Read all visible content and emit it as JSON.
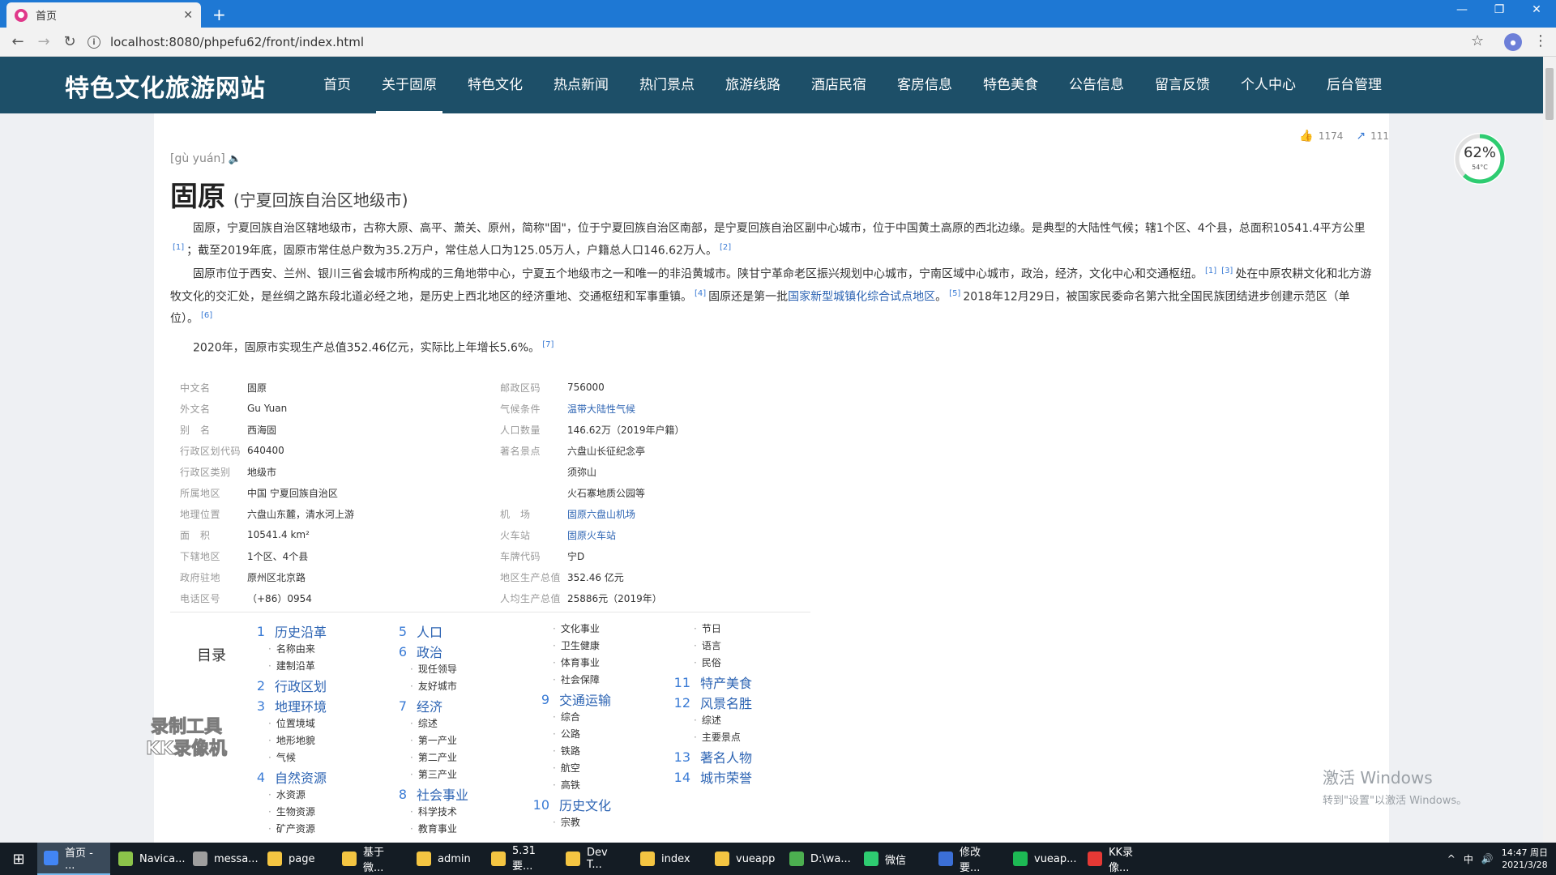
{
  "browser": {
    "tab_title": "首页",
    "url": "localhost:8080/phpefu62/front/index.html"
  },
  "site": {
    "logo": "特色文化旅游网站",
    "nav": [
      "首页",
      "关于固原",
      "特色文化",
      "热点新闻",
      "热门景点",
      "旅游线路",
      "酒店民宿",
      "客房信息",
      "特色美食",
      "公告信息",
      "留言反馈",
      "个人中心",
      "后台管理"
    ],
    "active_nav": "关于固原"
  },
  "article": {
    "likes": "1174",
    "shares": "111",
    "pinyin": "[gù yuán]",
    "title": "固原",
    "subtitle": "(宁夏回族自治区地级市)",
    "p1a": "固原，宁夏回族自治区辖地级市，古称大原、高平、萧关、原州，简称\"固\"，位于宁夏回族自治区南部，是宁夏回族自治区副中心城市，位于中国黄土高原的西北边缘。是典型的大陆性气候；辖1个区、4个县，总面积10541.4平方公里",
    "p1b": "；截至2019年底，固原市常住总户数为35.2万户，常住总人口为125.05万人，户籍总人口146.62万人。",
    "p2a": "固原市位于西安、兰州、银川三省会城市所构成的三角地带中心，宁夏五个地级市之一和唯一的非沿黄城市。陕甘宁革命老区振兴规划中心城市，宁南区域中心城市，政治，经济，文化中心和交通枢纽。",
    "p2b": "处在中原农耕文化和北方游牧文化的交汇处，是丝绸之路东段北道必经之地，是历史上西北地区的经济重地、交通枢纽和军事重镇。",
    "p2c": "固原还是第一批",
    "p2link": "国家新型城镇化综合试点地区",
    "p2d": "。",
    "p2e": "2018年12月29日，被国家民委命名第六批全国民族团结进步创建示范区（单位）。",
    "p3": "2020年，固原市实现生产总值352.46亿元，实际比上年增长5.6%。",
    "refs": [
      "[1]",
      "[2]",
      "[1]",
      "[3]",
      "[4]",
      "[5]",
      "[6]",
      "[7]"
    ]
  },
  "infobox": [
    {
      "k1": "中文名",
      "v1": "固原",
      "k2": "邮政区码",
      "v2": "756000"
    },
    {
      "k1": "外文名",
      "v1": "Gu Yuan",
      "k2": "气候条件",
      "v2": "温带大陆性气候"
    },
    {
      "k1": "别　名",
      "v1": "西海固",
      "k2": "人口数量",
      "v2": "146.62万（2019年户籍）"
    },
    {
      "k1": "行政区划代码",
      "v1": "640400",
      "k2": "著名景点",
      "v2": "六盘山长征纪念亭"
    },
    {
      "k1": "行政区类别",
      "v1": "地级市",
      "k2": "",
      "v2": "须弥山"
    },
    {
      "k1": "所属地区",
      "v1": "中国 宁夏回族自治区",
      "k2": "",
      "v2": "火石寨地质公园等"
    },
    {
      "k1": "地理位置",
      "v1": "六盘山东麓，清水河上游",
      "k2": "机　场",
      "v2": "固原六盘山机场"
    },
    {
      "k1": "面　积",
      "v1": "10541.4 km²",
      "k2": "火车站",
      "v2": "固原火车站"
    },
    {
      "k1": "下辖地区",
      "v1": "1个区、4个县",
      "k2": "车牌代码",
      "v2": "宁D"
    },
    {
      "k1": "政府驻地",
      "v1": "原州区北京路",
      "k2": "地区生产总值",
      "v2": "352.46 亿元"
    },
    {
      "k1": "电话区号",
      "v1": "（+86）0954",
      "k2": "人均生产总值",
      "v2": "25886元（2019年）"
    }
  ],
  "toc": {
    "label": "目录",
    "col1": [
      {
        "n": "1",
        "t": "历史沿革",
        "subs": [
          "名称由来",
          "建制沿革"
        ]
      },
      {
        "n": "2",
        "t": "行政区划",
        "subs": []
      },
      {
        "n": "3",
        "t": "地理环境",
        "subs": [
          "位置境域",
          "地形地貌",
          "气候"
        ]
      },
      {
        "n": "4",
        "t": "自然资源",
        "subs": [
          "水资源",
          "生物资源",
          "矿产资源"
        ]
      }
    ],
    "col2": [
      {
        "n": "5",
        "t": "人口",
        "subs": []
      },
      {
        "n": "6",
        "t": "政治",
        "subs": [
          "现任领导",
          "友好城市"
        ]
      },
      {
        "n": "7",
        "t": "经济",
        "subs": [
          "综述",
          "第一产业",
          "第二产业",
          "第三产业"
        ]
      },
      {
        "n": "8",
        "t": "社会事业",
        "subs": [
          "科学技术",
          "教育事业"
        ]
      }
    ],
    "col3_pre": [
      "文化事业",
      "卫生健康",
      "体育事业",
      "社会保障"
    ],
    "col3": [
      {
        "n": "9",
        "t": "交通运输",
        "subs": [
          "综合",
          "公路",
          "铁路",
          "航空",
          "高铁"
        ]
      },
      {
        "n": "10",
        "t": "历史文化",
        "subs": [
          "宗教"
        ]
      }
    ],
    "col4_pre": [
      "节日",
      "语言",
      "民俗"
    ],
    "col4": [
      {
        "n": "11",
        "t": "特产美食",
        "subs": []
      },
      {
        "n": "12",
        "t": "风景名胜",
        "subs": [
          "综述",
          "主要景点"
        ]
      },
      {
        "n": "13",
        "t": "著名人物",
        "subs": []
      },
      {
        "n": "14",
        "t": "城市荣誉",
        "subs": []
      }
    ]
  },
  "widget": {
    "pct": "62%",
    "temp": "54°C"
  },
  "overlay": {
    "recorder": [
      "录制工具",
      "KK录像机"
    ],
    "activate_title": "激活 Windows",
    "activate_sub": "转到\"设置\"以激活 Windows。"
  },
  "taskbar": {
    "items": [
      "首页 - ...",
      "Navica...",
      "messa...",
      "page",
      "基于微...",
      "admin",
      "5.31要...",
      "Dev T...",
      "index",
      "vueapp",
      "D:\\wa...",
      "微信",
      "修改要...",
      "vueap...",
      "KK录像..."
    ],
    "time": "14:47 周日",
    "date": "2021/3/28"
  },
  "colors": {
    "header_bg": "#1d4f68",
    "link": "#2d64b3",
    "chrome_tab": "#1e78d4"
  }
}
